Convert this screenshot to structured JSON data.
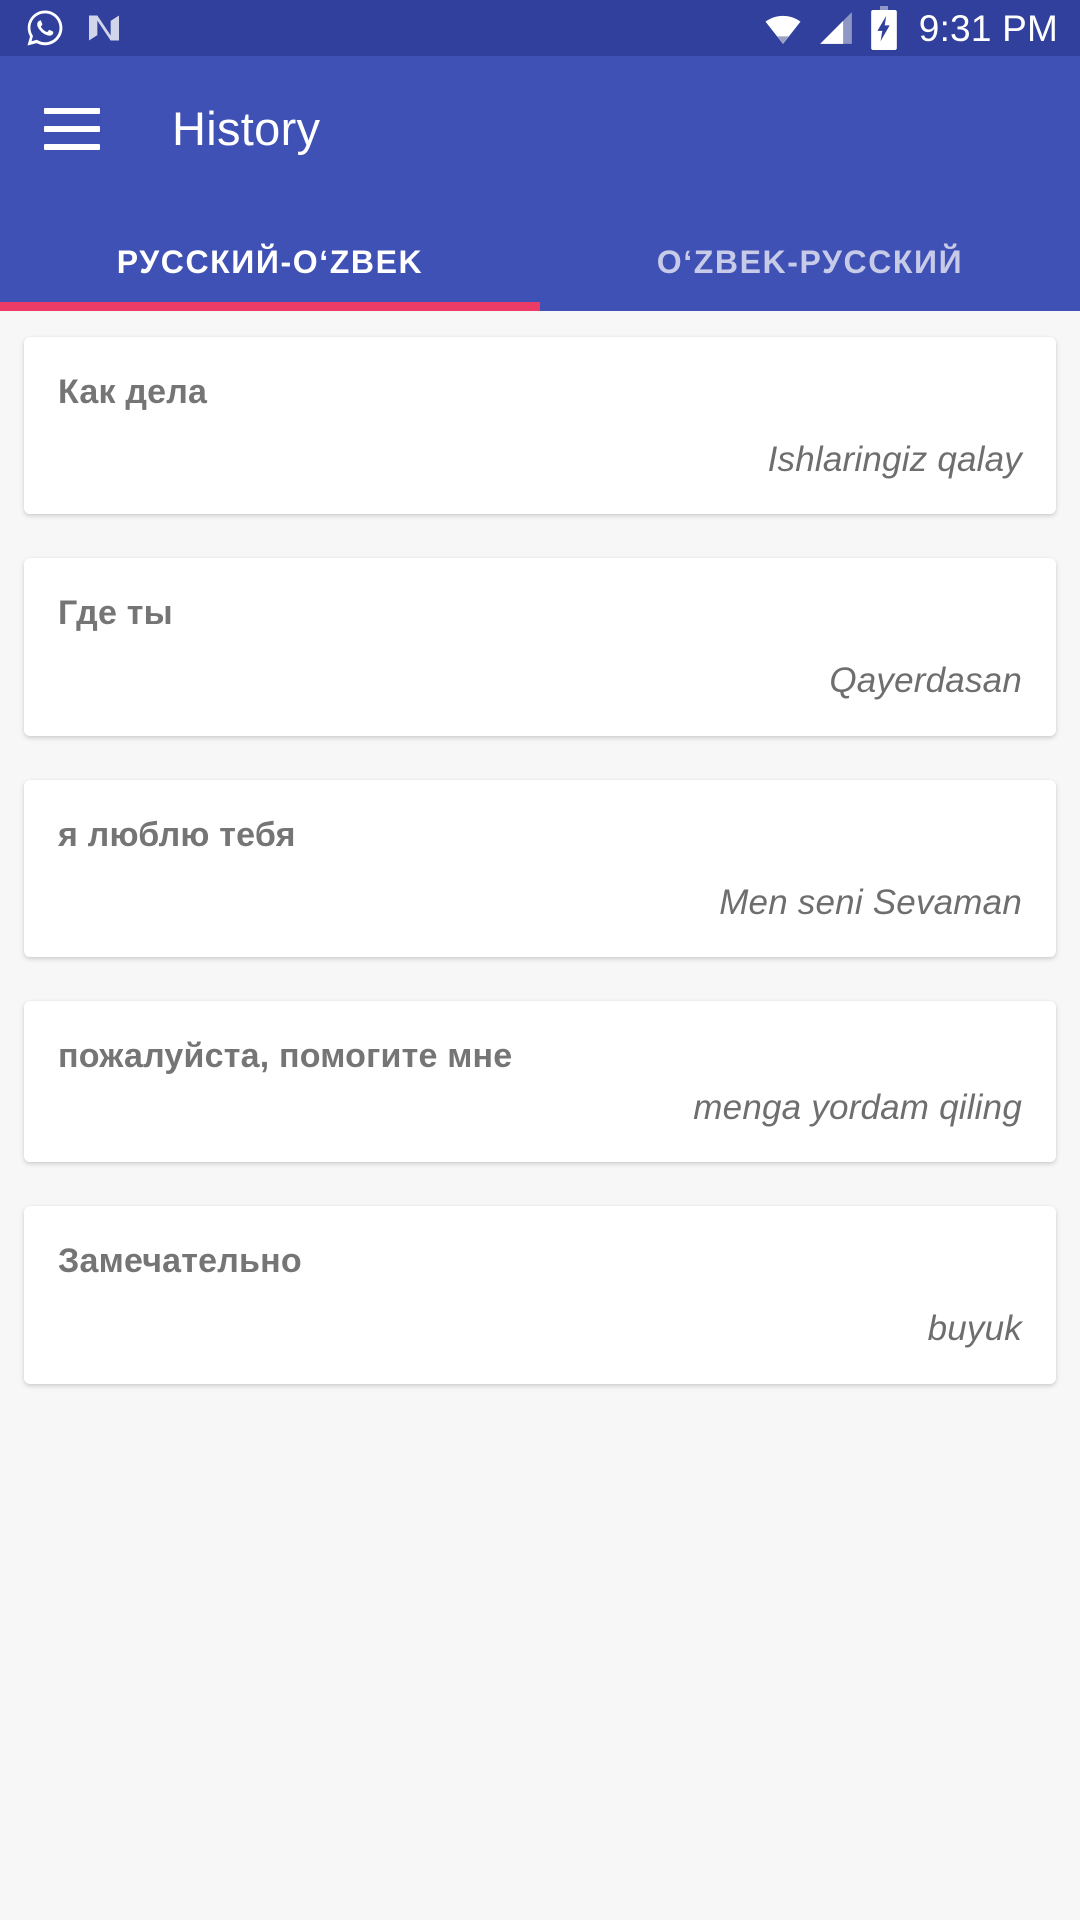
{
  "status_bar": {
    "icons": [
      "whatsapp-icon",
      "android-n-icon",
      "wifi-icon",
      "cell-signal-icon",
      "battery-charging-icon"
    ],
    "time": "9:31 PM",
    "background_color": "#31409C"
  },
  "app_bar": {
    "menu_icon": "hamburger-menu-icon",
    "title": "History",
    "background_color": "#3F51B5"
  },
  "tabs": {
    "active_index": 0,
    "indicator_color": "#ED3B68",
    "items": [
      {
        "label": "РУССКИЙ-OʻZBEK",
        "active": true
      },
      {
        "label": "OʻZBEK-РУССКИЙ",
        "active": false
      }
    ]
  },
  "history": {
    "items": [
      {
        "source": "Как дела",
        "target": "Ishlaringiz qalay",
        "compact": false
      },
      {
        "source": "Где ты",
        "target": "Qayerdasan",
        "compact": false
      },
      {
        "source": "я люблю тебя",
        "target": "Men seni Sevaman",
        "compact": false
      },
      {
        "source": "пожалуйста, помогите мне",
        "target": "menga yordam qiling",
        "compact": true
      },
      {
        "source": "Замечательно",
        "target": "buyuk",
        "compact": false
      }
    ]
  },
  "colors": {
    "page_background": "#F7F7F7",
    "card_background": "#FFFFFF",
    "source_text": "#757575",
    "target_text": "#6E6E6E",
    "tab_inactive_text": "#C7CBE8"
  }
}
